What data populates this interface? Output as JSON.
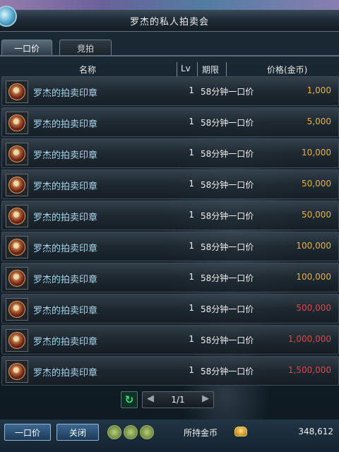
{
  "window": {
    "title": "罗杰的私人拍卖会"
  },
  "tabs": [
    {
      "label": "一口价",
      "active": true
    },
    {
      "label": "竞拍",
      "active": false
    }
  ],
  "columns": {
    "name": "名称",
    "lv": "Lv",
    "period": "期限",
    "price": "价格(金币)"
  },
  "items": [
    {
      "name": "罗杰的拍卖印章",
      "lv": "1",
      "period": "58分钟一口价",
      "price": "1,000",
      "price_tier": "normal"
    },
    {
      "name": "罗杰的拍卖印章",
      "lv": "1",
      "period": "58分钟一口价",
      "price": "5,000",
      "price_tier": "normal"
    },
    {
      "name": "罗杰的拍卖印章",
      "lv": "1",
      "period": "58分钟一口价",
      "price": "10,000",
      "price_tier": "normal"
    },
    {
      "name": "罗杰的拍卖印章",
      "lv": "1",
      "period": "58分钟一口价",
      "price": "50,000",
      "price_tier": "normal"
    },
    {
      "name": "罗杰的拍卖印章",
      "lv": "1",
      "period": "58分钟一口价",
      "price": "50,000",
      "price_tier": "normal"
    },
    {
      "name": "罗杰的拍卖印章",
      "lv": "1",
      "period": "58分钟一口价",
      "price": "100,000",
      "price_tier": "normal"
    },
    {
      "name": "罗杰的拍卖印章",
      "lv": "1",
      "period": "58分钟一口价",
      "price": "100,000",
      "price_tier": "normal"
    },
    {
      "name": "罗杰的拍卖印章",
      "lv": "1",
      "period": "58分钟一口价",
      "price": "500,000",
      "price_tier": "high"
    },
    {
      "name": "罗杰的拍卖印章",
      "lv": "1",
      "period": "58分钟一口价",
      "price": "1,000,000",
      "price_tier": "high"
    },
    {
      "name": "罗杰的拍卖印章",
      "lv": "1",
      "period": "58分钟一口价",
      "price": "1,500,000",
      "price_tier": "high"
    }
  ],
  "pagination": {
    "page": "1/1",
    "refresh_icon": "refresh-icon",
    "prev_icon": "arrow-left-icon",
    "next_icon": "arrow-right-icon"
  },
  "bottom": {
    "buy_label": "一口价",
    "close_label": "关闭",
    "gold_label": "所持金币",
    "gold_amount": "348,612",
    "coin_icon": "gold-coin-icon"
  },
  "colors": {
    "name_text": "#a9d6ee",
    "price_normal": "#e8b14a",
    "price_high": "#e04848",
    "panel_bg": "#13212b"
  }
}
